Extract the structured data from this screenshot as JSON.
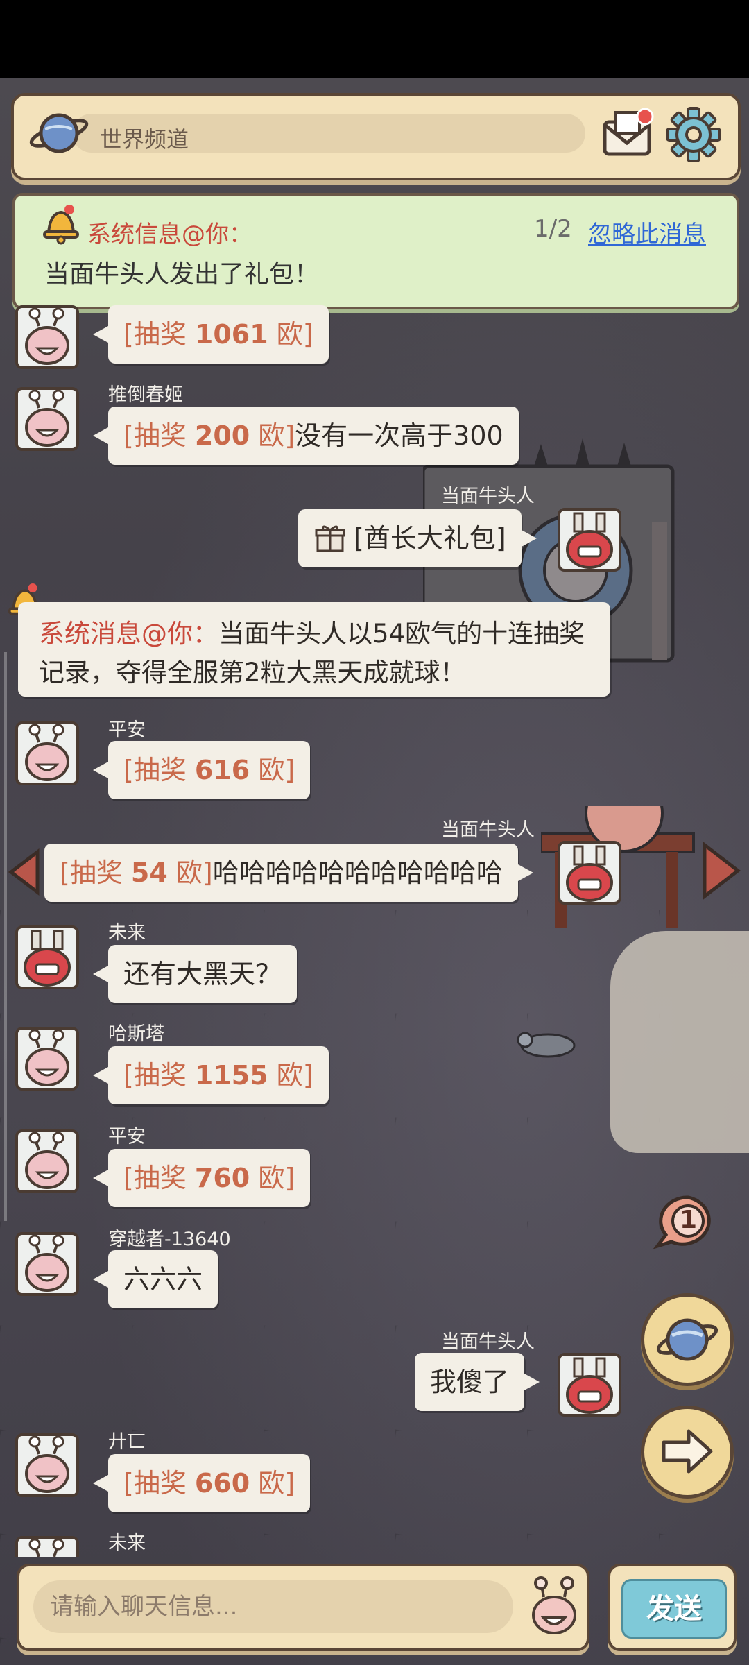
{
  "header": {
    "channel": "世界频道"
  },
  "banner": {
    "title": "系统信息@你：",
    "page": "1/2",
    "ignore": "忽略此消息",
    "body": "当面牛头人发出了礼包！"
  },
  "messages": [
    {
      "lottery": {
        "prefix": "[抽奖",
        "amount": "1061",
        "suffix": "欧]"
      },
      "text": ""
    },
    {
      "sender": "推倒春姬",
      "lottery": {
        "prefix": "[抽奖",
        "amount": "200",
        "suffix": "欧]"
      },
      "text": "没有一次高于300"
    },
    {
      "sender": "当面牛头人",
      "text": "[酋长大礼包]"
    },
    {
      "system_prefix": "系统消息@你：",
      "text": "当面牛头人以54欧气的十连抽奖记录，夺得全服第2粒大黑天成就球！"
    },
    {
      "sender": "平安",
      "lottery": {
        "prefix": "[抽奖",
        "amount": "616",
        "suffix": "欧]"
      }
    },
    {
      "sender": "当面牛头人",
      "lottery": {
        "prefix": "[抽奖",
        "amount": "54",
        "suffix": "欧]"
      },
      "text": "哈哈哈哈哈哈哈哈哈哈哈"
    },
    {
      "sender": "未来",
      "text": "还有大黑天？"
    },
    {
      "sender": "哈斯塔",
      "lottery": {
        "prefix": "[抽奖",
        "amount": "1155",
        "suffix": "欧]"
      }
    },
    {
      "sender": "平安",
      "lottery": {
        "prefix": "[抽奖",
        "amount": "760",
        "suffix": "欧]"
      }
    },
    {
      "sender": "穿越者-13640",
      "text": "六六六"
    },
    {
      "sender": "当面牛头人",
      "text": "我傻了"
    },
    {
      "sender": "廾匸",
      "lottery": {
        "prefix": "[抽奖",
        "amount": "660",
        "suffix": "欧]"
      }
    },
    {
      "sender": "未来"
    }
  ],
  "unread_badge": "1",
  "input": {
    "placeholder": "请输入聊天信息..."
  },
  "send_label": "发送",
  "colors": {
    "lottery": "#c9694a",
    "banner_bg": "#dff0c8",
    "link": "#2f67d6"
  }
}
